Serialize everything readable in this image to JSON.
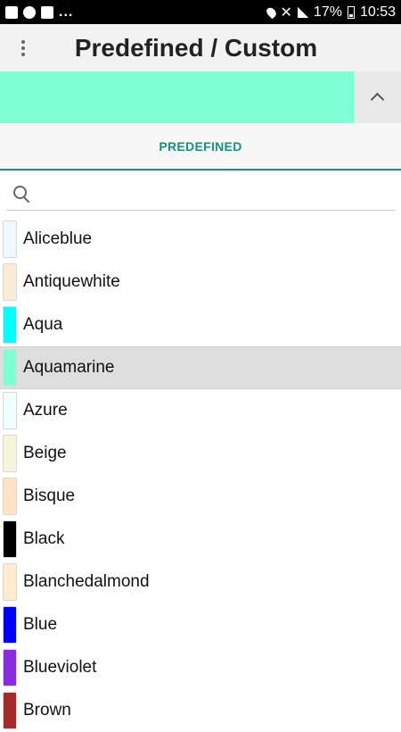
{
  "status_bar": {
    "left_dots": "...",
    "battery": "17%",
    "time": "10:53"
  },
  "app_bar": {
    "title": "Predefined / Custom",
    "menu_icon": "kebab-menu-icon"
  },
  "preview": {
    "color": "#7FFFD4",
    "collapse_icon": "chevron-up-icon"
  },
  "tabs": [
    {
      "label": "PREDEFINED",
      "active": true
    }
  ],
  "accent_color": "#1b8f7e",
  "search": {
    "icon": "search-icon",
    "value": "",
    "placeholder": ""
  },
  "colors": [
    {
      "name": "Aliceblue",
      "hex": "#F0F8FF"
    },
    {
      "name": "Antiquewhite",
      "hex": "#FAEBD7"
    },
    {
      "name": "Aqua",
      "hex": "#00FFFF"
    },
    {
      "name": "Aquamarine",
      "hex": "#7FFFD4",
      "selected": true
    },
    {
      "name": "Azure",
      "hex": "#F0FFFF"
    },
    {
      "name": "Beige",
      "hex": "#F5F5DC"
    },
    {
      "name": "Bisque",
      "hex": "#FFE4C4"
    },
    {
      "name": "Black",
      "hex": "#000000"
    },
    {
      "name": "Blanchedalmond",
      "hex": "#FFEBCD"
    },
    {
      "name": "Blue",
      "hex": "#0000FF"
    },
    {
      "name": "Blueviolet",
      "hex": "#8A2BE2"
    },
    {
      "name": "Brown",
      "hex": "#A52A2A"
    }
  ]
}
